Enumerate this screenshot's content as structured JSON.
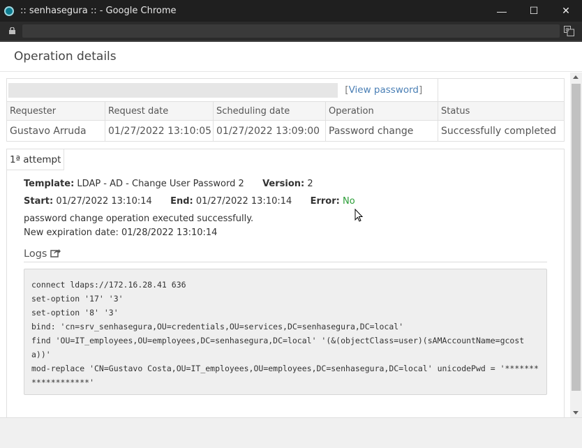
{
  "window": {
    "title": ":: senhasegura :: - Google Chrome",
    "minimize": "—",
    "maximize": "☐",
    "close": "✕"
  },
  "header": {
    "title": "Operation details"
  },
  "info": {
    "view_password_open": "[",
    "view_password": "View password",
    "view_password_close": "]",
    "columns": [
      "Requester",
      "Request date",
      "Scheduling date",
      "Operation",
      "Status"
    ],
    "row": [
      "Gustavo Arruda",
      "01/27/2022 13:10:05",
      "01/27/2022 13:09:00",
      "Password change",
      "Successfully completed"
    ]
  },
  "attempt": {
    "tab": "1ª attempt",
    "template_label": "Template:",
    "template_value": "LDAP - AD - Change User Password 2",
    "version_label": "Version:",
    "version_value": "2",
    "start_label": "Start:",
    "start_value": "01/27/2022 13:10:14",
    "end_label": "End:",
    "end_value": "01/27/2022 13:10:14",
    "error_label": "Error:",
    "error_value": "No",
    "message": "password change operation executed successfully.",
    "expiration_label": "New expiration date:",
    "expiration_value": "01/28/2022 13:10:14",
    "logs_title": "Logs",
    "logs": [
      "connect ldaps://172.16.28.41 636",
      "set-option '17' '3'",
      "set-option '8' '3'",
      "bind: 'cn=srv_senhasegura,OU=credentials,OU=services,DC=senhasegura,DC=local'",
      "find 'OU=IT_employees,OU=employees,DC=senhasegura,DC=local' '(&(objectClass=user)(sAMAccountName=gcosta))'",
      "mod-replace 'CN=Gustavo Costa,OU=IT_employees,OU=employees,DC=senhasegura,DC=local' unicodePwd = '*******************'"
    ]
  },
  "colors": {
    "link": "#4a7fb5",
    "success": "#2a9d36",
    "titlebar": "#1f1f1f"
  }
}
